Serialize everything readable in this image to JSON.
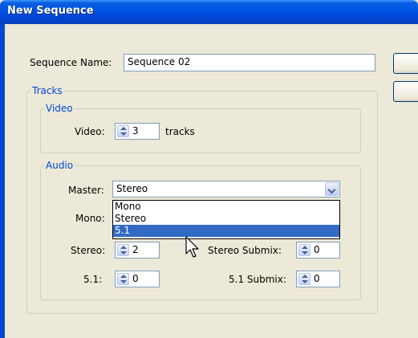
{
  "window": {
    "title": "New Sequence"
  },
  "sequence_name": {
    "label": "Sequence Name:",
    "value": "Sequence 02"
  },
  "tracks": {
    "legend": "Tracks",
    "video": {
      "legend": "Video",
      "label": "Video:",
      "value": "3",
      "suffix": "tracks"
    },
    "audio": {
      "legend": "Audio",
      "master": {
        "label": "Master:",
        "value": "Stereo",
        "options": [
          "Mono",
          "Stereo",
          "5.1"
        ],
        "highlighted": "5.1"
      },
      "mono": {
        "label": "Mono:"
      },
      "stereo": {
        "label": "Stereo:",
        "value": "2"
      },
      "stereo_submix": {
        "label": "Stereo Submix:",
        "value": "0"
      },
      "surround": {
        "label": "5.1:",
        "value": "0"
      },
      "surround_submix": {
        "label": "5.1 Submix:",
        "value": "0"
      }
    }
  },
  "colors": {
    "title_bar": "#0054e3",
    "dialog_bg": "#ece9d8",
    "group_legend": "#0046d5",
    "selection": "#316ac5"
  },
  "icons": [
    "spin-up-down-icon",
    "dropdown-chevron-icon",
    "mouse-pointer-icon"
  ]
}
